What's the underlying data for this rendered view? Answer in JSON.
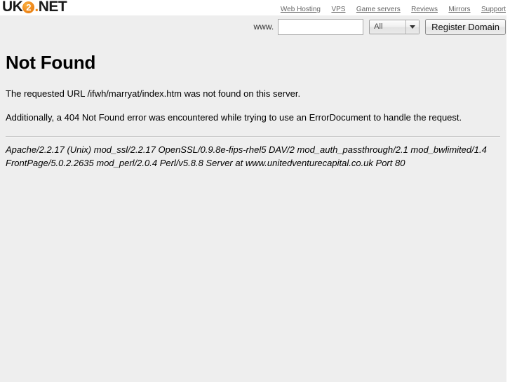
{
  "header": {
    "logo": {
      "prefix": "UK",
      "badge": "2",
      "dot": ".",
      "suffix": "NET",
      "badge_color": "#f08a1c"
    },
    "nav": [
      {
        "label": "Web Hosting",
        "name": "nav-web-hosting"
      },
      {
        "label": "VPS",
        "name": "nav-vps"
      },
      {
        "label": "Game servers",
        "name": "nav-game-servers"
      },
      {
        "label": "Reviews",
        "name": "nav-reviews"
      },
      {
        "label": "Mirrors",
        "name": "nav-mirrors"
      },
      {
        "label": "Support",
        "name": "nav-support"
      }
    ]
  },
  "search": {
    "www_label": "www.",
    "domain_value": "",
    "domain_placeholder": "",
    "tld_selected": "All",
    "tld_options": [
      "All"
    ],
    "register_label": "Register Domain"
  },
  "main": {
    "title": "Not Found",
    "paragraph_1": "The requested URL /ifwh/marryat/index.htm was not found on this server.",
    "paragraph_2": "Additionally, a 404 Not Found error was encountered while trying to use an ErrorDocument to handle the request.",
    "signature_line_1": "Apache/2.2.17 (Unix) mod_ssl/2.2.17 OpenSSL/0.9.8e-fips-rhel5 DAV/2 mod_auth_passthrough/2.1 mod_bwlimited/1.4",
    "signature_line_2": "FrontPage/5.0.2.2635 mod_perl/2.0.4 Perl/v5.8.8 Server at www.unitedventurecapital.co.uk Port 80"
  }
}
